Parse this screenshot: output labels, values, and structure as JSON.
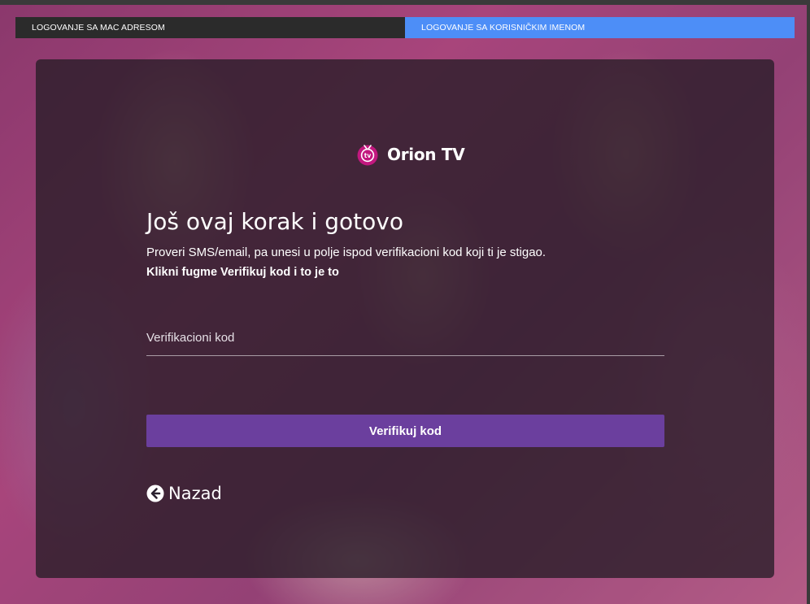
{
  "tabs": {
    "mac": "LOGOVANJE SA MAC ADRESOM",
    "username": "LOGOVANJE SA KORISNIČKIM IMENOM"
  },
  "brand": {
    "name": "Orion TV",
    "icon": "orion-tv-logo-icon",
    "icon_text": "tv",
    "accent": "#c2187f"
  },
  "content": {
    "heading": "Još ovaj korak i gotovo",
    "description": "Proveri SMS/email, pa unesi u polje ispod verifikacioni kod koji ti je stigao.",
    "instruction": "Klikni fugme Verifikuj kod i to je to"
  },
  "form": {
    "code_placeholder": "Verifikacioni kod",
    "code_value": "",
    "verify_label": "Verifikuj kod"
  },
  "back": {
    "label": "Nazad",
    "icon": "arrow-left-circle-icon"
  },
  "colors": {
    "active_tab": "#4d8ef7",
    "inactive_tab": "#2b2b2b",
    "button": "#6b3f9e"
  }
}
